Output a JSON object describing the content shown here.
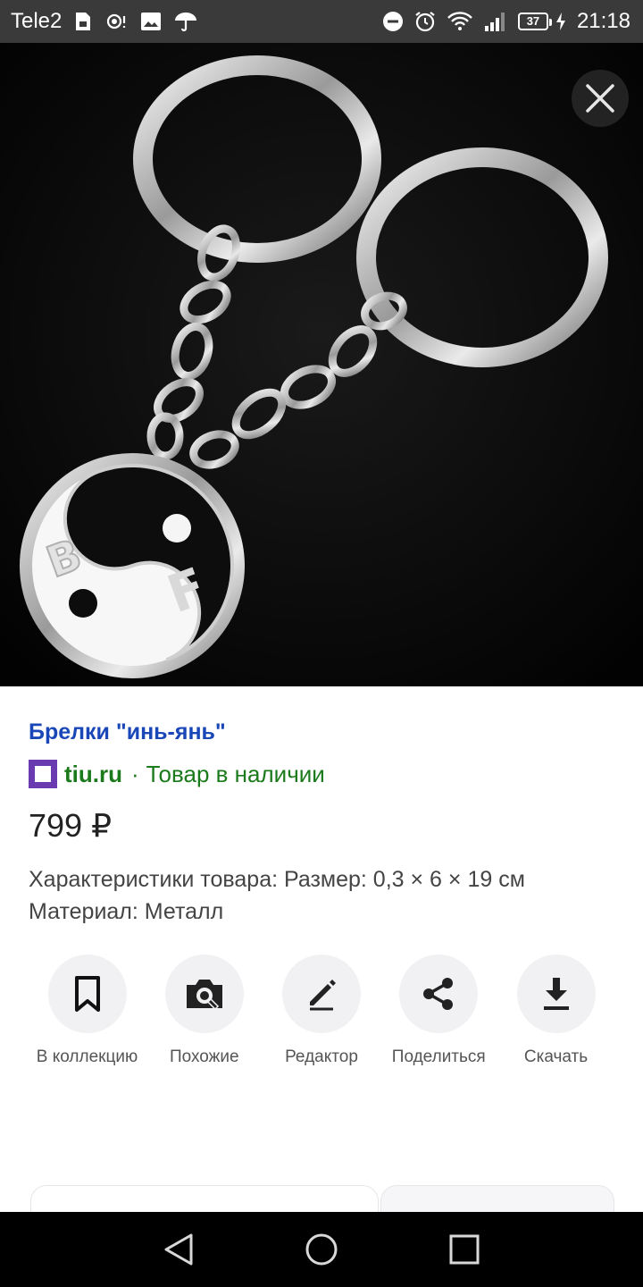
{
  "status_bar": {
    "carrier": "Tele2",
    "battery": "37",
    "time": "21:18",
    "icons_left": [
      "sim-card-icon",
      "hotspot-icon",
      "gallery-icon",
      "umbrella-icon"
    ],
    "icons_right": [
      "dnd-icon",
      "alarm-icon",
      "wifi-icon",
      "signal-icon",
      "battery-icon",
      "charging-icon"
    ]
  },
  "image": {
    "subject": "keychain-rings-icon",
    "letter_b": "B",
    "letter_f": "F"
  },
  "product": {
    "title": "Брелки \"инь-янь\"",
    "source": "tiu.ru",
    "separator": "·",
    "availability": "Товар в наличии",
    "price": "799 ₽",
    "description": "Характеристики товара: Размер: 0,3 × 6 × 19 см Материал: Металл"
  },
  "actions": [
    {
      "label": "В коллекцию",
      "icon": "bookmark-icon"
    },
    {
      "label": "Похожие",
      "icon": "camera-search-icon"
    },
    {
      "label": "Редактор",
      "icon": "pencil-icon"
    },
    {
      "label": "Поделиться",
      "icon": "share-icon"
    },
    {
      "label": "Скачать",
      "icon": "download-icon"
    }
  ],
  "colors": {
    "title": "#1a47b8",
    "source": "#1b7a1b",
    "favicon": "#6a3bb0",
    "action_bg": "#f1f1f3"
  },
  "nav": [
    "back-icon",
    "home-icon",
    "recents-icon"
  ]
}
